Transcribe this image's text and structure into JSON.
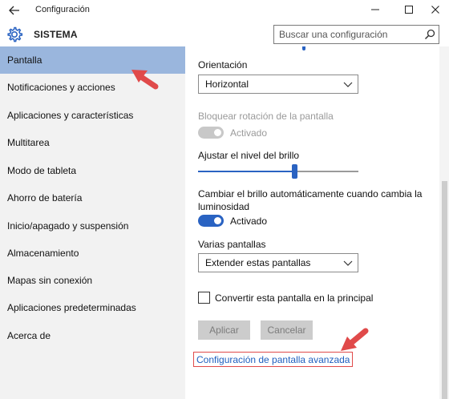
{
  "window": {
    "title": "Configuración",
    "back_icon": "back-arrow-icon",
    "controls": [
      "minimize-icon",
      "maximize-icon",
      "close-icon"
    ]
  },
  "header": {
    "icon": "gear-icon",
    "section": "SISTEMA",
    "search_placeholder": "Buscar una configuración",
    "search_icon": "search-icon"
  },
  "sidebar": {
    "items": [
      {
        "label": "Pantalla",
        "active": true
      },
      {
        "label": "Notificaciones y acciones"
      },
      {
        "label": "Aplicaciones y características"
      },
      {
        "label": "Multitarea"
      },
      {
        "label": "Modo de tableta"
      },
      {
        "label": "Ahorro de batería"
      },
      {
        "label": "Inicio/apagado y suspensión"
      },
      {
        "label": "Almacenamiento"
      },
      {
        "label": "Mapas sin conexión"
      },
      {
        "label": "Aplicaciones predeterminadas"
      },
      {
        "label": "Acerca de"
      }
    ]
  },
  "main": {
    "orientation": {
      "label": "Orientación",
      "value": "Horizontal"
    },
    "rotation_lock": {
      "label": "Bloquear rotación de la pantalla",
      "state": "Activado",
      "enabled": false
    },
    "brightness": {
      "label": "Ajustar el nivel del brillo",
      "level": 0.6
    },
    "auto_brightness": {
      "label": "Cambiar el brillo automáticamente cuando cambia la luminosidad",
      "state": "Activado",
      "on": true
    },
    "multiple_displays": {
      "label": "Varias pantallas",
      "value": "Extender estas pantallas"
    },
    "main_display": {
      "label": "Convertir esta pantalla en la principal",
      "checked": false
    },
    "apply_label": "Aplicar",
    "cancel_label": "Cancelar",
    "advanced_link": "Configuración de pantalla avanzada"
  },
  "colors": {
    "accent": "#2a63c2",
    "selection": "#9ab6dd",
    "annotation": "#e04a4a"
  }
}
